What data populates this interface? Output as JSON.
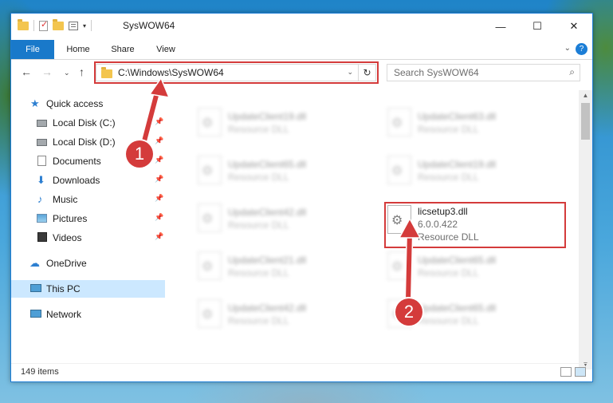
{
  "window": {
    "title": "SysWOW64",
    "controls": {
      "minimize": "—",
      "maximize": "☐",
      "close": "✕"
    }
  },
  "ribbon": {
    "tabs": [
      "File",
      "Home",
      "Share",
      "View"
    ],
    "help": "?"
  },
  "address": {
    "path": "C:\\Windows\\SysWOW64",
    "search_placeholder": "Search SysWOW64"
  },
  "sidebar": {
    "items": [
      {
        "label": "Quick access"
      },
      {
        "label": "Local Disk (C:)"
      },
      {
        "label": "Local Disk (D:)"
      },
      {
        "label": "Documents"
      },
      {
        "label": "Downloads"
      },
      {
        "label": "Music"
      },
      {
        "label": "Pictures"
      },
      {
        "label": "Videos"
      },
      {
        "label": "OneDrive"
      },
      {
        "label": "This PC"
      },
      {
        "label": "Network"
      }
    ]
  },
  "files": {
    "left_column": [
      {
        "name": "UpdateClient19.dll",
        "type": "Resource DLL"
      },
      {
        "name": "UpdateClient65.dll",
        "type": "Resource DLL"
      },
      {
        "name": "UpdateClient42.dll",
        "type": "Resource DLL"
      },
      {
        "name": "UpdateClient21.dll",
        "type": "Resource DLL"
      },
      {
        "name": "UpdateClient42.dll",
        "type": "Resource DLL"
      }
    ],
    "right_column": [
      {
        "name": "UpdateClient63.dll",
        "type": "Resource DLL"
      },
      {
        "name": "UpdateClient19.dll",
        "type": "Resource DLL"
      },
      {
        "name": "UpdateClient65.dll",
        "type": "Resource DLL"
      },
      {
        "name": "UpdateClient65.dll",
        "type": "Resource DLL"
      }
    ],
    "target": {
      "name": "licsetup3.dll",
      "version": "6.0.0.422",
      "type": "Resource DLL"
    }
  },
  "status": {
    "count": "149 items"
  },
  "annotations": {
    "step1": "1",
    "step2": "2",
    "color": "#d43b3b"
  }
}
